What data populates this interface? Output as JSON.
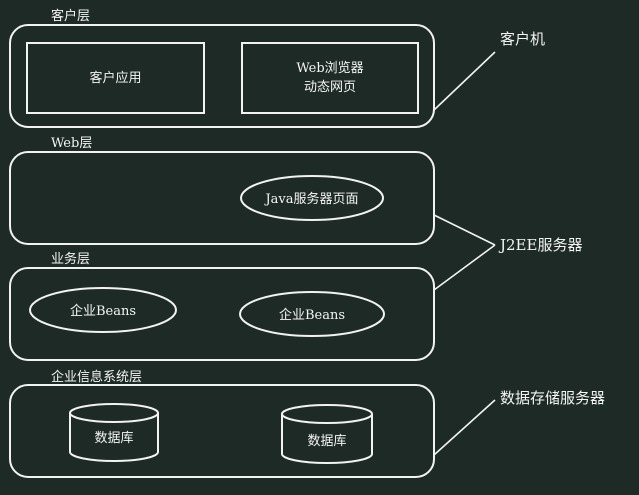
{
  "layers": {
    "client": {
      "title": "客户层",
      "app": "客户应用",
      "browser_line1": "Web浏览器",
      "browser_line2": "动态网页"
    },
    "web": {
      "title": "Web层",
      "jsp": "Java服务器页面"
    },
    "business": {
      "title": "业务层",
      "bean1": "企业Beans",
      "bean2": "企业Beans"
    },
    "eis": {
      "title": "企业信息系统层",
      "db1": "数据库",
      "db2": "数据库"
    }
  },
  "machines": {
    "client": "客户机",
    "j2ee": "J2EE服务器",
    "storage": "数据存储服务器"
  },
  "colors": {
    "background": "#1e2a25",
    "foreground": "#f2f2f2"
  }
}
